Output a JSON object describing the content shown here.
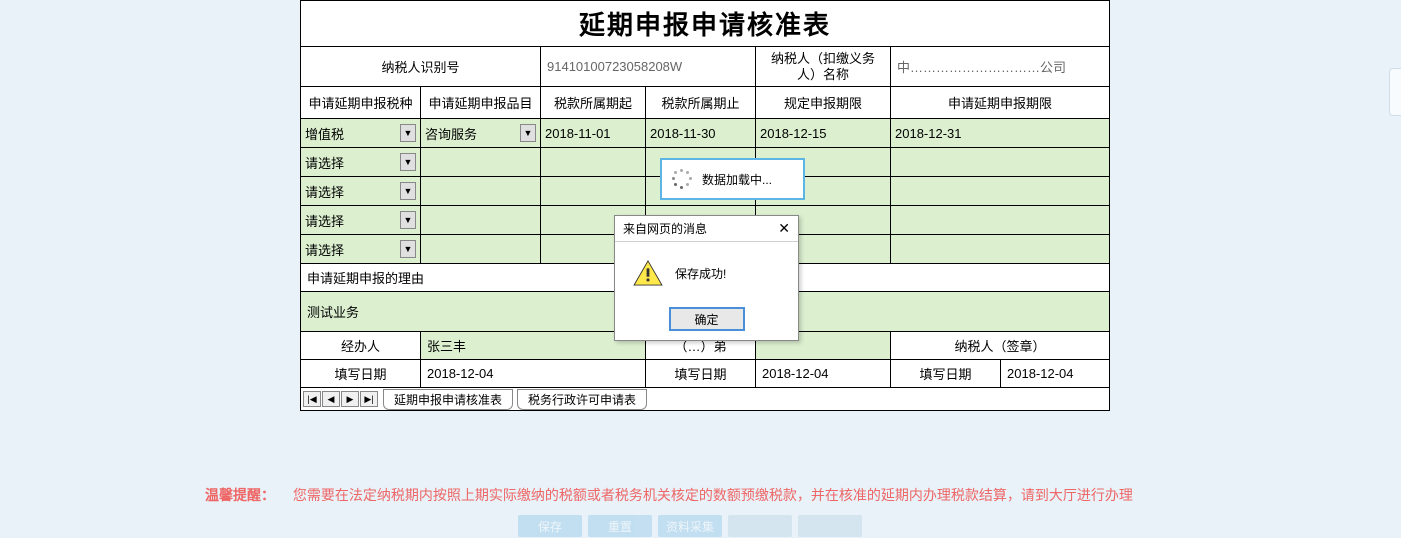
{
  "title": "延期申报申请核准表",
  "row1": {
    "label1": "纳税人识别号",
    "value1": "91410100723058208W",
    "label2": "纳税人（扣缴义务人）名称",
    "value2": "中…………………………公司"
  },
  "headers": {
    "c1": "申请延期申报税种",
    "c2": "申请延期申报品目",
    "c3": "税款所属期起",
    "c4": "税款所属期止",
    "c5": "规定申报期限",
    "c6": "申请延期申报期限"
  },
  "rows": [
    {
      "c1": "增值税",
      "c2": "咨询服务",
      "c3": "2018-11-01",
      "c4": "2018-11-30",
      "c5": "2018-12-15",
      "c6": "2018-12-31"
    },
    {
      "c1": "请选择",
      "c2": "",
      "c3": "",
      "c4": "",
      "c5": "",
      "c6": ""
    },
    {
      "c1": "请选择",
      "c2": "",
      "c3": "",
      "c4": "",
      "c5": "",
      "c6": ""
    },
    {
      "c1": "请选择",
      "c2": "",
      "c3": "",
      "c4": "",
      "c5": "",
      "c6": ""
    },
    {
      "c1": "请选择",
      "c2": "",
      "c3": "",
      "c4": "",
      "c5": "",
      "c6": ""
    }
  ],
  "reason": {
    "label": "申请延期申报的理由",
    "value": "测试业务"
  },
  "sig": {
    "r1": {
      "l1": "经办人",
      "v1": "张三丰",
      "l2": "（…）弟",
      "l3": "纳税人（签章）"
    },
    "r2": {
      "l1": "填写日期",
      "v1": "2018-12-04",
      "l2": "填写日期",
      "v2": "2018-12-04",
      "l3": "填写日期",
      "v3": "2018-12-04"
    }
  },
  "tabs": {
    "t1": "延期申报申请核准表",
    "t2": "税务行政许可申请表"
  },
  "loading": "数据加载中...",
  "dialog": {
    "title": "来自网页的消息",
    "msg": "保存成功!",
    "ok": "确定"
  },
  "tip": {
    "label": "温馨提醒：",
    "text": "您需要在法定纳税期内按照上期实际缴纳的税额或者税务机关核定的数额预缴税款，并在核准的延期内办理税款结算，请到大厅进行办理"
  },
  "btns": {
    "b1": "保存",
    "b2": "重置",
    "b3": "资料采集",
    "b4": "",
    "b5": ""
  }
}
